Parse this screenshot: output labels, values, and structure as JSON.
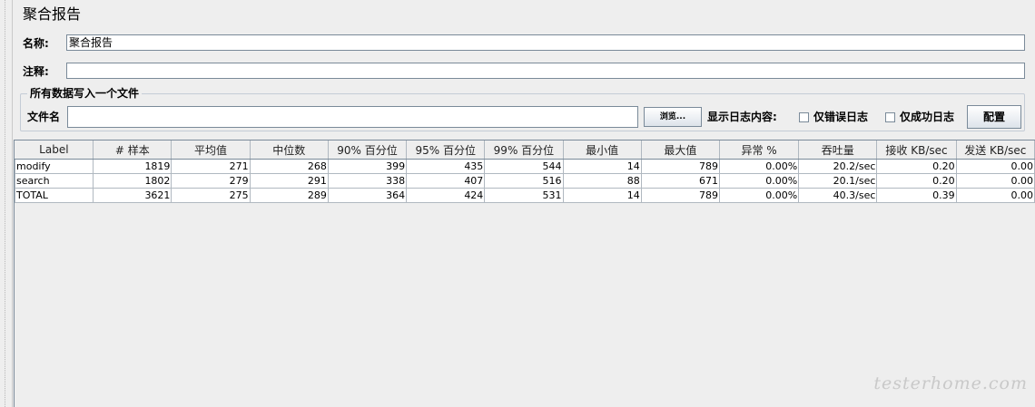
{
  "panel": {
    "title": "聚合报告"
  },
  "name_row": {
    "label": "名称:",
    "value": "聚合报告"
  },
  "comment_row": {
    "label": "注释:",
    "value": ""
  },
  "file_group": {
    "title": "所有数据写入一个文件",
    "filename_label": "文件名",
    "filename_value": "",
    "browse_label": "浏览...",
    "log_content_label": "显示日志内容:",
    "errors_only_label": "仅错误日志",
    "errors_only_checked": false,
    "success_only_label": "仅成功日志",
    "success_only_checked": false,
    "configure_label": "配置"
  },
  "table": {
    "columns": [
      "Label",
      "# 样本",
      "平均值",
      "中位数",
      "90% 百分位",
      "95% 百分位",
      "99% 百分位",
      "最小值",
      "最大值",
      "异常 %",
      "吞吐量",
      "接收 KB/sec",
      "发送 KB/sec"
    ],
    "rows": [
      [
        "modify",
        "1819",
        "271",
        "268",
        "399",
        "435",
        "544",
        "14",
        "789",
        "0.00%",
        "20.2/sec",
        "0.20",
        "0.00"
      ],
      [
        "search",
        "1802",
        "279",
        "291",
        "338",
        "407",
        "516",
        "88",
        "671",
        "0.00%",
        "20.1/sec",
        "0.20",
        "0.00"
      ],
      [
        "TOTAL",
        "3621",
        "275",
        "289",
        "364",
        "424",
        "531",
        "14",
        "789",
        "0.00%",
        "40.3/sec",
        "0.39",
        "0.00"
      ]
    ]
  },
  "watermark": "testerhome.com"
}
